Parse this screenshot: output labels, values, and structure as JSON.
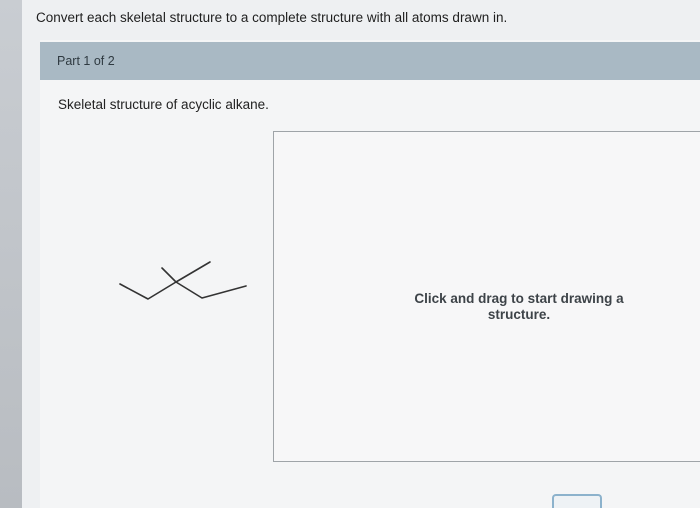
{
  "instruction": "Convert each skeletal structure to a complete structure with all atoms drawn in.",
  "part": {
    "label": "Part 1 of 2"
  },
  "question": {
    "prompt": "Skeletal structure of acyclic alkane."
  },
  "canvas": {
    "hint": "Click and drag to start drawing a structure."
  },
  "icons": {
    "tool": "crosshair-pencil-icon"
  },
  "colors": {
    "part_header": "#a9b9c4",
    "canvas_border": "#9fa4a8",
    "button_border": "#8cb2cc"
  }
}
